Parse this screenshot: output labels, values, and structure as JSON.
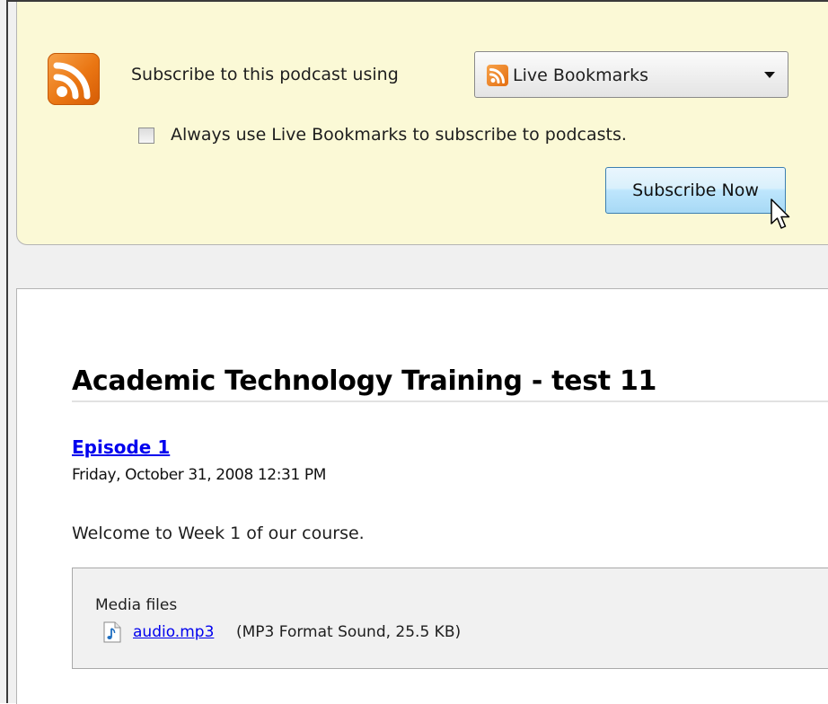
{
  "subscribe": {
    "label": "Subscribe to this podcast using",
    "reader_selected": "Live Bookmarks",
    "always_use_label": "Always use Live Bookmarks to subscribe to podcasts.",
    "always_use_checked": false,
    "button_label": "Subscribe Now"
  },
  "feed": {
    "title": "Academic Technology Training - test 11"
  },
  "episode": {
    "title": "Episode 1",
    "date": "Friday, October 31, 2008 12:31 PM",
    "description": "Welcome to Week 1 of our course.",
    "media_heading": "Media files",
    "media_file_name": "audio.mp3",
    "media_file_meta": "(MP3 Format Sound, 25.5 KB)"
  },
  "colors": {
    "panel_bg": "#fbf9d6",
    "rss_orange": "#ea7613",
    "link": "#0000ee",
    "button_border": "#3c7fb1"
  },
  "icons": {
    "feed_icon": "rss-feed-icon",
    "file_icon": "audio-file-icon",
    "cursor": "mouse-pointer-icon"
  }
}
